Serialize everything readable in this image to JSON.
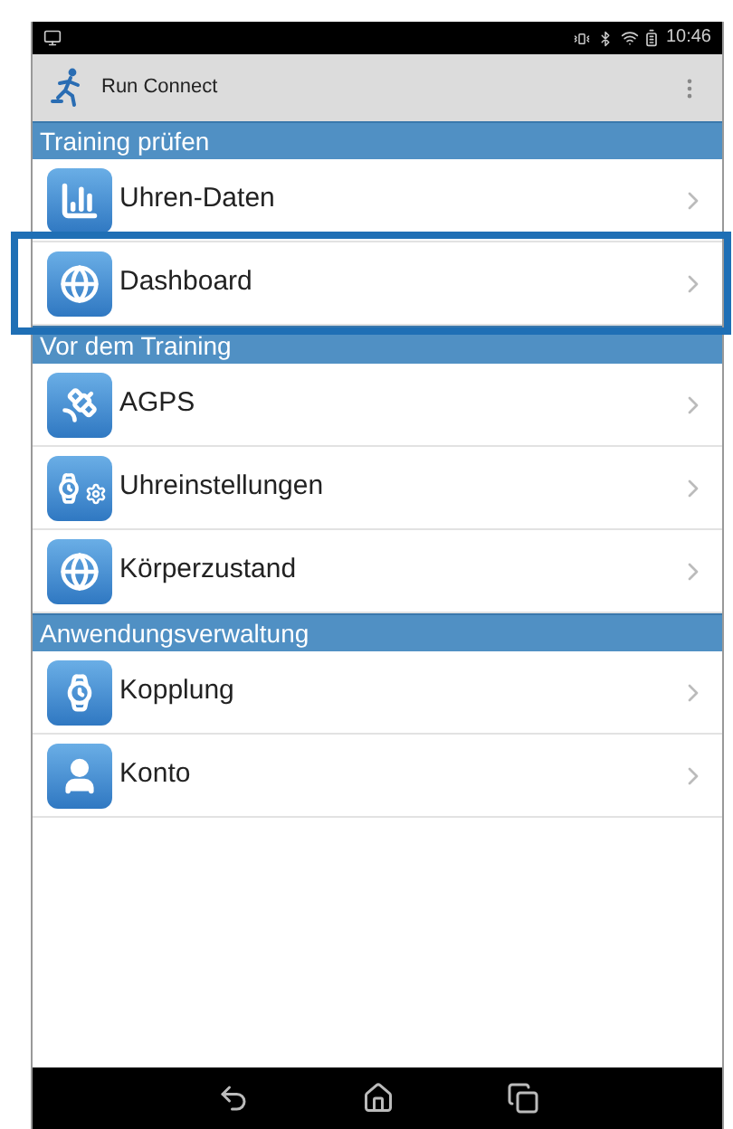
{
  "status_bar": {
    "time": "10:46"
  },
  "app_bar": {
    "title": "Run Connect"
  },
  "sections": [
    {
      "title": "Training prüfen",
      "items": [
        {
          "label": "Uhren-Daten",
          "kind": "chart",
          "highlighted": false
        },
        {
          "label": "Dashboard",
          "kind": "globe",
          "highlighted": true
        }
      ]
    },
    {
      "title": "Vor dem Training",
      "items": [
        {
          "label": "AGPS",
          "kind": "satellite",
          "highlighted": false
        },
        {
          "label": "Uhreinstellungen",
          "kind": "watch-settings",
          "highlighted": false
        },
        {
          "label": "Körperzustand",
          "kind": "globe",
          "highlighted": false
        }
      ]
    },
    {
      "title": "Anwendungsverwaltung",
      "items": [
        {
          "label": "Kopplung",
          "kind": "watch",
          "highlighted": false
        },
        {
          "label": "Konto",
          "kind": "person",
          "highlighted": false
        }
      ]
    }
  ]
}
